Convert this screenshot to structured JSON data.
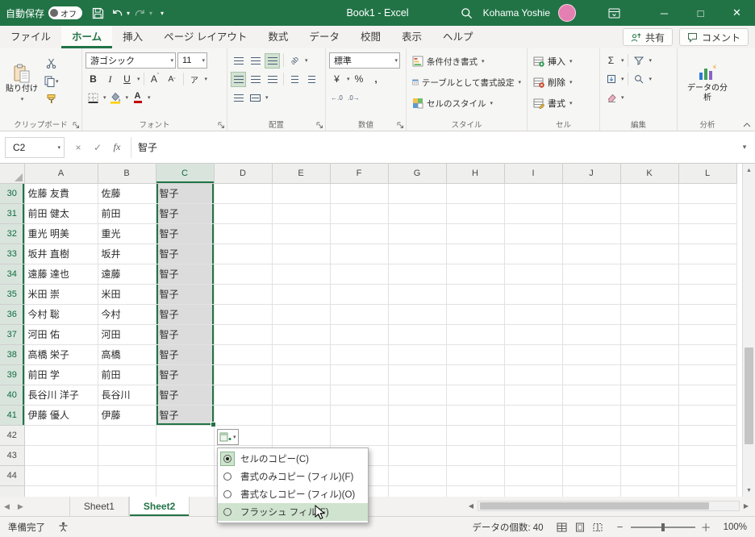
{
  "window": {
    "title": "Book1  -  Excel"
  },
  "titlebar": {
    "autosave_label": "自動保存",
    "autosave_state": "オフ",
    "user_name": "Kohama Yoshie"
  },
  "tabs": {
    "file": "ファイル",
    "home": "ホーム",
    "insert": "挿入",
    "page_layout": "ページ レイアウト",
    "formulas": "数式",
    "data": "データ",
    "review": "校閲",
    "view": "表示",
    "help": "ヘルプ",
    "share": "共有",
    "comments": "コメント"
  },
  "ribbon": {
    "clipboard": {
      "paste": "貼り付け",
      "group": "クリップボード"
    },
    "font": {
      "name": "游ゴシック",
      "size": "11",
      "group": "フォント"
    },
    "alignment": {
      "group": "配置"
    },
    "number": {
      "format": "標準",
      "group": "数値"
    },
    "styles": {
      "conditional": "条件付き書式",
      "format_table": "テーブルとして書式設定",
      "cell_styles": "セルのスタイル",
      "group": "スタイル"
    },
    "cells": {
      "insert": "挿入",
      "delete": "削除",
      "format": "書式",
      "group": "セル"
    },
    "editing": {
      "autosum": "Σ",
      "group": "編集"
    },
    "analysis": {
      "label": "データの分析",
      "group": "分析"
    }
  },
  "formula_bar": {
    "name_box": "C2",
    "fx": "fx",
    "value": "智子"
  },
  "grid": {
    "columns": [
      "A",
      "B",
      "C",
      "D",
      "E",
      "F",
      "G",
      "H",
      "I",
      "J",
      "K",
      "L"
    ],
    "selected_column": "C",
    "rows": [
      {
        "n": "30",
        "a": "佐藤 友貴",
        "b": "佐藤",
        "c": "智子"
      },
      {
        "n": "31",
        "a": "前田 健太",
        "b": "前田",
        "c": "智子"
      },
      {
        "n": "32",
        "a": "重光 明美",
        "b": "重光",
        "c": "智子"
      },
      {
        "n": "33",
        "a": "坂井 直樹",
        "b": "坂井",
        "c": "智子"
      },
      {
        "n": "34",
        "a": "遠藤 達也",
        "b": "遠藤",
        "c": "智子"
      },
      {
        "n": "35",
        "a": "米田 崇",
        "b": "米田",
        "c": "智子"
      },
      {
        "n": "36",
        "a": "今村 聡",
        "b": "今村",
        "c": "智子"
      },
      {
        "n": "37",
        "a": "河田 佑",
        "b": "河田",
        "c": "智子"
      },
      {
        "n": "38",
        "a": "高橋 栄子",
        "b": "高橋",
        "c": "智子"
      },
      {
        "n": "39",
        "a": "前田 学",
        "b": "前田",
        "c": "智子"
      },
      {
        "n": "40",
        "a": "長谷川 洋子",
        "b": "長谷川",
        "c": "智子"
      },
      {
        "n": "41",
        "a": "伊藤 優人",
        "b": "伊藤",
        "c": "智子"
      },
      {
        "n": "42"
      },
      {
        "n": "43"
      },
      {
        "n": "44"
      }
    ]
  },
  "fill_menu": {
    "items": [
      "セルのコピー(C)",
      "書式のみコピー (フィル)(F)",
      "書式なしコピー (フィル)(O)",
      "フラッシュ フィル(F)"
    ]
  },
  "sheet_bar": {
    "sheet1": "Sheet1",
    "sheet2": "Sheet2"
  },
  "status_bar": {
    "ready": "準備完了",
    "count": "データの個数: 40",
    "zoom": "100%"
  }
}
